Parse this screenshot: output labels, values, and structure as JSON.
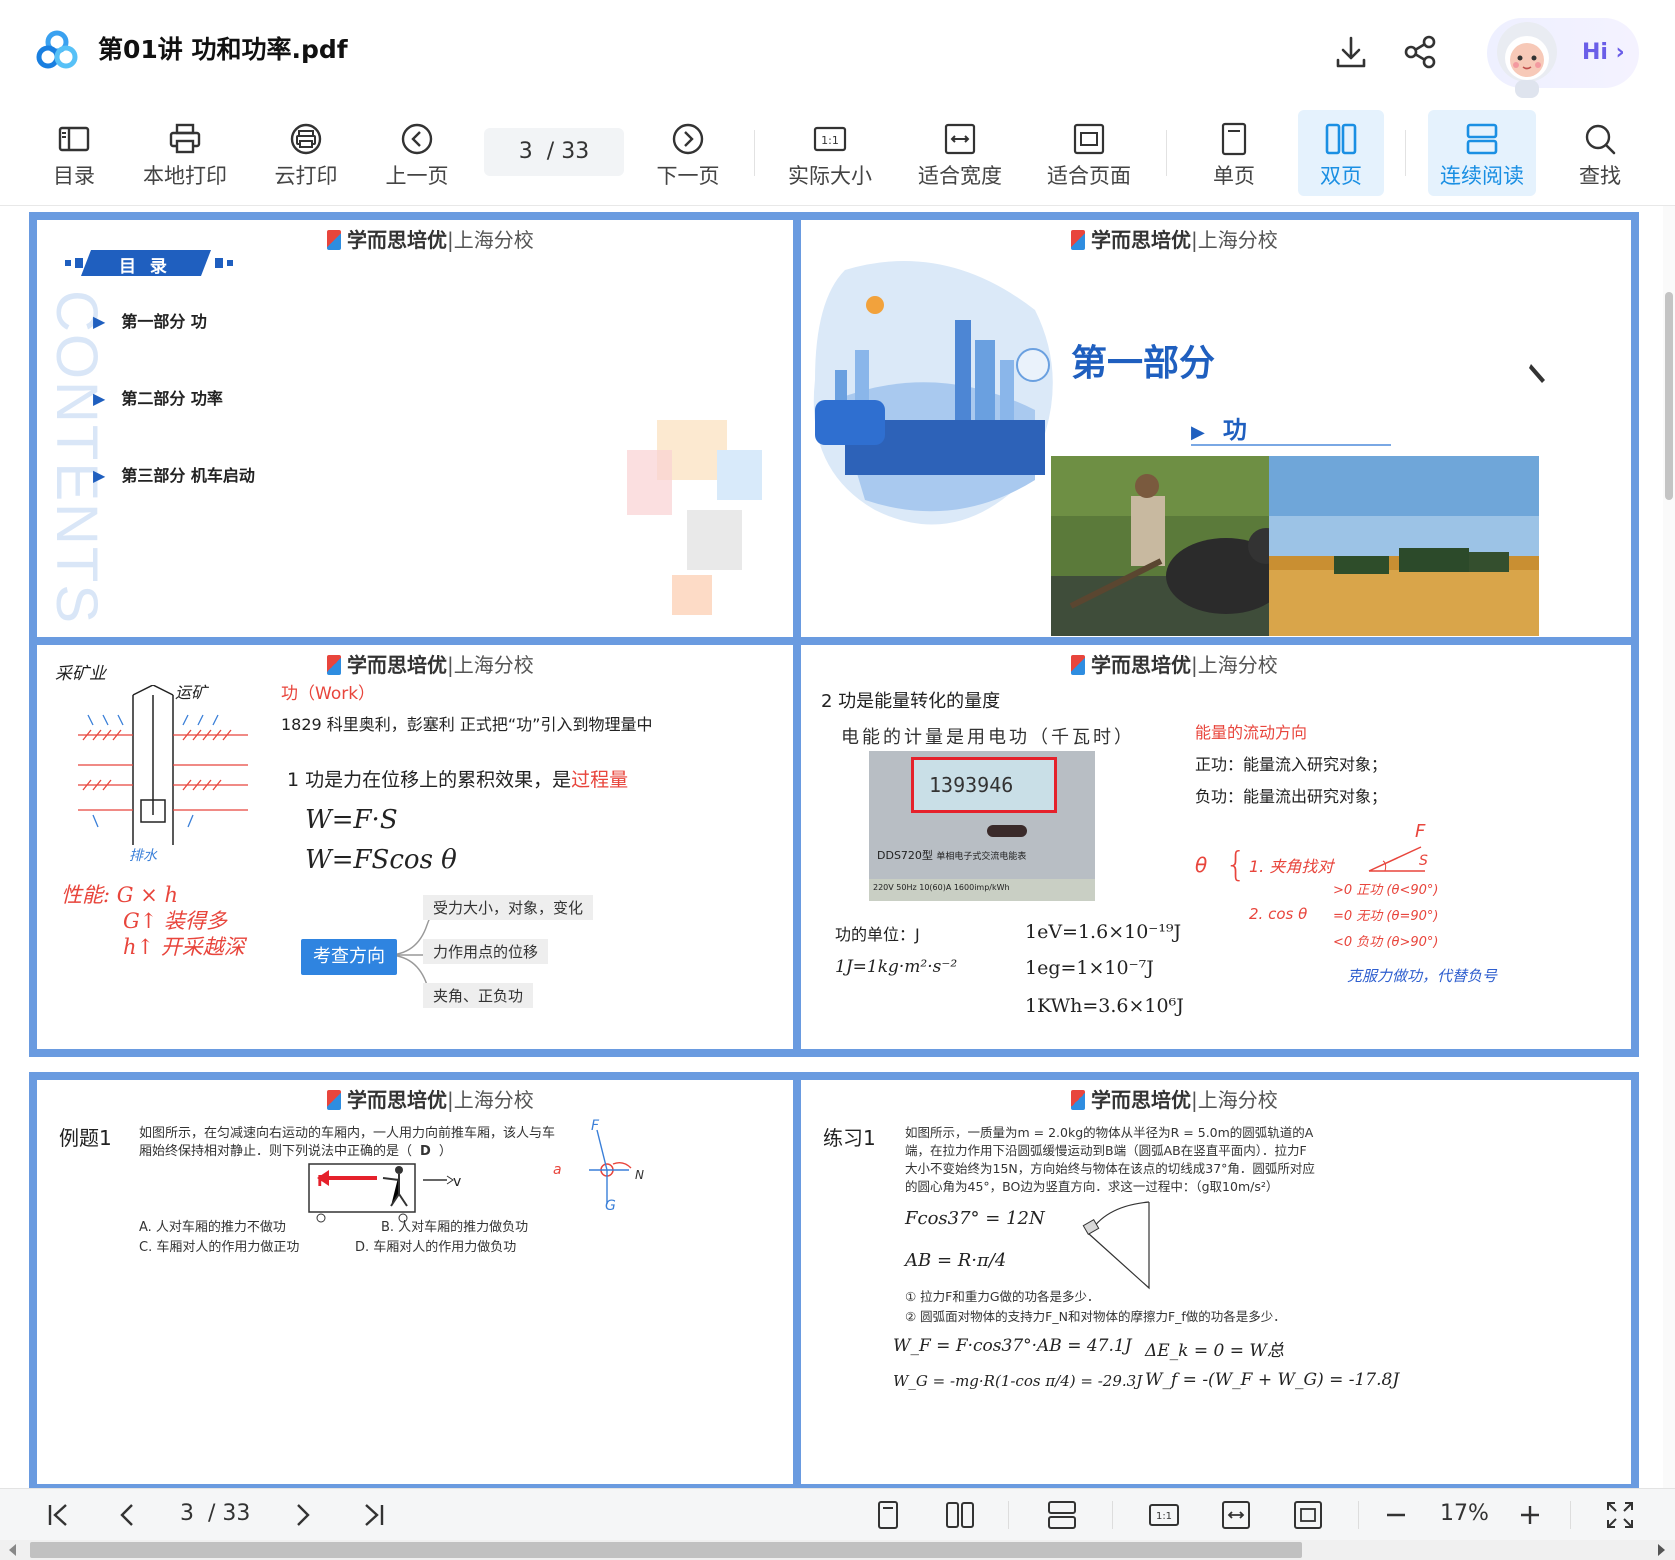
{
  "window": {
    "title": "第01讲 功和功率.pdf"
  },
  "header_actions": {
    "hi_label": "Hi"
  },
  "toolbar": {
    "items": [
      {
        "label": "目录",
        "icon": "sidebar-icon"
      },
      {
        "label": "本地打印",
        "icon": "printer-icon"
      },
      {
        "label": "云打印",
        "icon": "cloud-print-icon"
      },
      {
        "label": "上一页",
        "icon": "prev-page-icon"
      },
      {
        "label": "下一页",
        "icon": "next-page-icon"
      },
      {
        "label": "实际大小",
        "icon": "actual-size-icon"
      },
      {
        "label": "适合宽度",
        "icon": "fit-width-icon"
      },
      {
        "label": "适合页面",
        "icon": "fit-page-icon"
      },
      {
        "label": "单页",
        "icon": "single-page-icon"
      },
      {
        "label": "双页",
        "icon": "double-page-icon"
      },
      {
        "label": "连续阅读",
        "icon": "continuous-icon"
      },
      {
        "label": "查找",
        "icon": "search-icon"
      }
    ],
    "page_current": "3",
    "page_total": "/ 33"
  },
  "brand": {
    "name": "学而思培优",
    "branch": "上海分校"
  },
  "slides": {
    "s1": {
      "toc_title": "目 录",
      "watermark": "CONTENTS",
      "items": [
        "第一部分 功",
        "第二部分 功率",
        "第三部分 机车启动"
      ]
    },
    "s2": {
      "heading": "第一部分",
      "sub": "功"
    },
    "s3": {
      "hand_title": "采矿业",
      "hand_arrow": "运矿",
      "hand_bottom": "排水",
      "hand_notes": [
        "性能: G × h",
        "G↑ 装得多",
        "h↑ 开采越深"
      ],
      "work_title": "功（Work）",
      "history": "1829 科里奥利，彭塞利 正式把“功”引入到物理量中",
      "def_prefix": "1 功是力在位移上的累积效果，是",
      "def_highlight": "过程量",
      "formula1": "W=F·S",
      "formula2": "W=FScos θ",
      "mind_center": "考查方向",
      "mind_branches": [
        "受力大小，对象，变化",
        "力作用点的位移",
        "夹角、正负功"
      ]
    },
    "s4": {
      "title": "2 功是能量转化的量度",
      "hand1": "电能的计量是用电功（千瓦时）",
      "meter_reading": "1393946",
      "meter_model": "DDS720型",
      "meter_desc": "单相电子式交流电能表",
      "meter_rating": "220V  50Hz  10(60)A  1600imp/kWh",
      "energy_title": "能量的流动方向",
      "positive": "正功：能量流入研究对象；",
      "negative": "负功：能量流出研究对象；",
      "unit_label": "功的单位：J",
      "unit_formula": "1J=1kg·m²·s⁻²",
      "eq1": "1eV=1.6×10⁻¹⁹J",
      "eq2": "1eg=1×10⁻⁷J",
      "eq3": "1KWh=3.6×10⁶J",
      "hand_theta": "θ",
      "hand_line1": "1. 夹角找对",
      "hand_line2": "2. cos θ",
      "hand_gt": ">0 正功 (θ<90°)",
      "hand_eq": "=0 无功 (θ=90°)",
      "hand_lt": "<0 负功 (θ>90°)",
      "hand_blue": "克服力做功，代替负号",
      "hand_F": "F",
      "hand_S": "S"
    },
    "s5": {
      "label": "例题1",
      "q1": "如图所示，在匀减速向右运动的车厢内，一人用力向前推车厢，该人与车",
      "q2": "厢始终保持相对静止．则下列说法中正确的是（",
      "answer": "D",
      "q_end": "）",
      "optA": "A. 人对车厢的推力不做功",
      "optB": "B. 人对车厢的推力做负功",
      "optC": "C. 车厢对人的作用力做正功",
      "optD": "D. 车厢对人的作用力做负功",
      "fig_F": "F",
      "fig_v": "v",
      "fig_a": "a",
      "fig_N": "N",
      "fig_G": "G",
      "fig_F2": "F"
    },
    "s6": {
      "label": "练习1",
      "p1": "如图所示，一质量为m = 2.0kg的物体从半径为R = 5.0m的圆弧轨道的A",
      "p2": "端，在拉力作用下沿圆弧缓慢运动到B端（圆弧AB在竖直平面内）．拉力F",
      "p3": "大小不变始终为15N，方向始终与物体在该点的切线成37°角．圆弧所对应",
      "p4": "的圆心角为45°，BO边为竖直方向．求这一过程中：（g取10m/s²）",
      "h1": "Fcos37° = 12N",
      "h2": "AB = R·π/4",
      "q1": "① 拉力F和重力G做的功各是多少．",
      "q2": "② 圆弧面对物体的支持力F_N和对物体的摩擦力F_f做的功各是多少．",
      "h3": "W_F = F·cos37°·AB = 47.1J",
      "h4": "ΔE_k = 0 = W总",
      "h5": "W_G = -mg·R(1-cos π/4) = -29.3J",
      "h6": "W_f = -(W_F + W_G) = -17.8J"
    }
  },
  "bottom": {
    "page_current": "3",
    "page_total": "/ 33",
    "zoom": "17%"
  },
  "colors": {
    "accent": "#1a8fe3",
    "slide_border": "#6a9be0",
    "red": "#e8453c"
  }
}
